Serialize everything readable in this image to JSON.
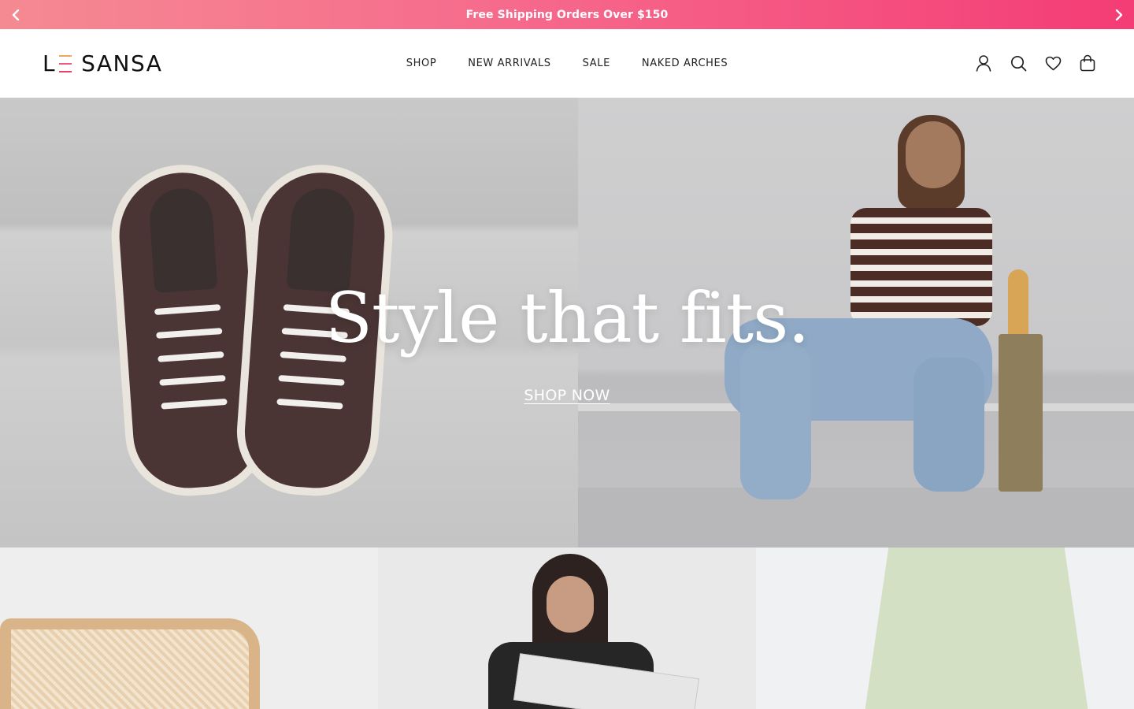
{
  "announcement": {
    "text": "Free Shipping Orders Over $150",
    "prev_icon": "chevron-left-icon",
    "next_icon": "chevron-right-icon",
    "gradient_colors": [
      "#f58a92",
      "#f43c75"
    ]
  },
  "header": {
    "logo": {
      "left": "L",
      "right": "SANSA",
      "accent_colors": [
        "#f0a55a",
        "#f05a7e",
        "#ee3c6b"
      ]
    },
    "nav": [
      {
        "label": "SHOP"
      },
      {
        "label": "NEW ARRIVALS"
      },
      {
        "label": "SALE"
      },
      {
        "label": "NAKED ARCHES"
      }
    ],
    "icons": [
      "account-icon",
      "search-icon",
      "wishlist-heart-icon",
      "cart-bag-icon"
    ]
  },
  "hero": {
    "title": "Style that fits.",
    "cta": "SHOP NOW"
  },
  "categories": [
    {
      "name": "category-tile-1"
    },
    {
      "name": "category-tile-2"
    },
    {
      "name": "category-tile-3"
    }
  ]
}
